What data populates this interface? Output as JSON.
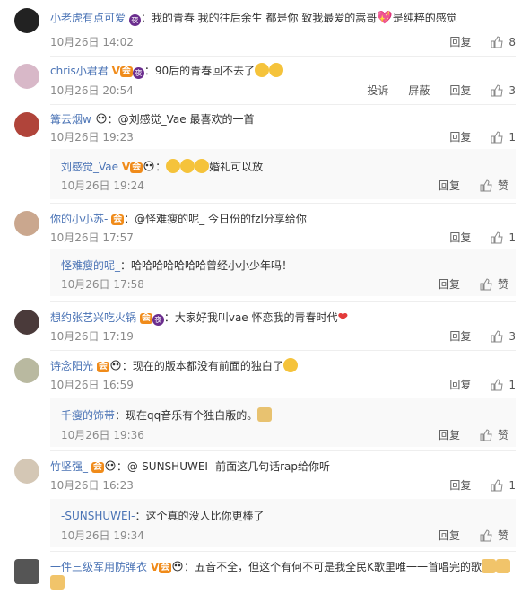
{
  "actions": {
    "reply": "回复",
    "report": "投诉",
    "block": "屏蔽",
    "like": "赞"
  },
  "comments": [
    {
      "user": "小老虎有点可爱",
      "text": "：我的青春 我的往后余生 都是你 致我最爱的嵩哥",
      "text2": "是纯粹的感觉",
      "time": "10月26日 14:02",
      "likes": "8"
    },
    {
      "user": "chris小君君",
      "text": "：90后的青春回不去了",
      "time": "10月26日 20:54",
      "likes": "3"
    },
    {
      "user": "篝云烟w",
      "text": "：@刘感觉_Vae  最喜欢的一首",
      "time": "10月26日 19:23",
      "likes": "1",
      "reply": {
        "user": "刘感觉_Vae",
        "text": "婚礼可以放",
        "time": "10月26日 19:24"
      }
    },
    {
      "user": "你的小小苏-",
      "text": "：@怪难瘦的呢_ 今日份的fzl分享给你",
      "time": "10月26日 17:57",
      "likes": "1",
      "reply": {
        "user": "怪难瘦的呢_",
        "text": "：哈哈哈哈哈哈哈曾经小小少年吗！",
        "time": "10月26日 17:58"
      }
    },
    {
      "user": "想约张艺兴吃火锅",
      "text": "：大家好我叫vae  怀恋我的青春时代",
      "time": "10月26日 17:19",
      "likes": "3"
    },
    {
      "user": "诗念阳光",
      "text": "：现在的版本都没有前面的独白了",
      "time": "10月26日 16:59",
      "likes": "1",
      "reply": {
        "user": "千瘦的饰带",
        "text": "：现在qq音乐有个独白版的。",
        "time": "10月26日 19:36"
      }
    },
    {
      "user": "竹坚强_",
      "text": "：@-SUNSHUWEI- 前面这几句话rap给你听",
      "time": "10月26日 16:23",
      "likes": "1",
      "reply": {
        "user": "-SUNSHUWEI-",
        "text": "：这个真的没人比你更棒了",
        "time": "10月26日 19:34"
      }
    },
    {
      "user": "一件三级军用防弹衣",
      "text": "：五音不全，但这个有何不可是我全民K歌里唯一一首唱完的歌"
    }
  ]
}
